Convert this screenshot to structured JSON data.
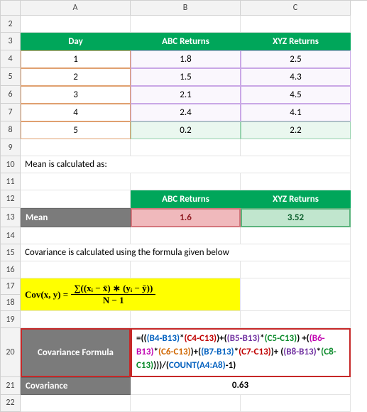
{
  "columns": [
    "A",
    "B",
    "C"
  ],
  "rows": [
    "2",
    "3",
    "4",
    "5",
    "6",
    "7",
    "8",
    "9",
    "10",
    "11",
    "12",
    "13",
    "14",
    "15",
    "16",
    "17",
    "18",
    "19",
    "20",
    "21",
    "22"
  ],
  "headers": {
    "day": "Day",
    "abc": "ABC Returns",
    "xyz": "XYZ Returns"
  },
  "data": [
    {
      "day": "1",
      "abc": "1.8",
      "xyz": "2.5"
    },
    {
      "day": "2",
      "abc": "1.5",
      "xyz": "4.3"
    },
    {
      "day": "3",
      "abc": "2.1",
      "xyz": "4.5"
    },
    {
      "day": "4",
      "abc": "2.4",
      "xyz": "4.1"
    },
    {
      "day": "5",
      "abc": "0.2",
      "xyz": "2.2"
    }
  ],
  "mean_text": "Mean is calculated as:",
  "mean_label": "Mean",
  "mean": {
    "abc": "1.6",
    "xyz": "3.52"
  },
  "cov_text": "Covariance is calculated using the formula given below",
  "cov_symbol": "Cov(x, y) =",
  "cov_num": "∑((xᵢ − x̄) ∗ (yᵢ − ȳ))",
  "cov_den": "N − 1",
  "cov_formula_label": "Covariance Formula",
  "formula_parts": {
    "p1": "=((",
    "b4": "(B4-B13)",
    "s1": "*",
    "c4": "(C4-C13)",
    "s2": ")+(",
    "b5": "(B5-B13)",
    "s3": "*",
    "c5": "(C5-C13)",
    "s4": ")",
    "s5": "+(",
    "b6": "(B6-B13)",
    "s6": "*",
    "c6": "(C6-C13)",
    "s7": ")+(",
    "b7": "(B7-B13)",
    "s8": "*",
    "c7": "(C7-C13)",
    "s9": ")+",
    "s10": "(",
    "b8": "(B8-B13)",
    "s11": "*",
    "c8": "(C8-C13)",
    "s12": ")))/(",
    "cnt": "COUNT(",
    "a48": "A4:A8",
    "s13": ")",
    "tail": "-1)"
  },
  "cov_result_label": "Covariance",
  "cov_result": "0.63"
}
